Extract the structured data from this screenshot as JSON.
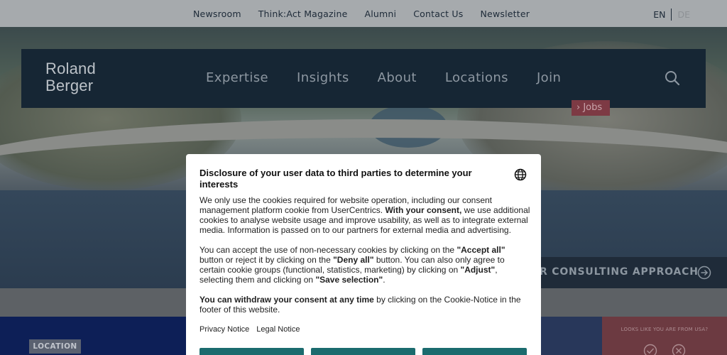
{
  "topnav": {
    "links": [
      "Newsroom",
      "Think:Act Magazine",
      "Alumni",
      "Contact Us",
      "Newsletter"
    ],
    "lang_en": "EN",
    "lang_de": "DE"
  },
  "header": {
    "logo_line1": "Roland",
    "logo_line2": "Berger",
    "menu": [
      "Expertise",
      "Insights",
      "About",
      "Locations",
      "Join"
    ],
    "search_icon": "search-icon"
  },
  "hero": {
    "jobs_label": "› Jobs",
    "approach_label": "R CONSULTING APPROACH",
    "approach_icon": "arrow-right-circle-icon"
  },
  "bottom": {
    "location_badge": "LOCATION",
    "geo_prompt": "LOOKS LIKE YOU ARE FROM USA?",
    "geo_icons": [
      "check-circle-icon",
      "close-circle-icon"
    ]
  },
  "cookie": {
    "title": "Disclosure of your user data to third parties to determine your interests",
    "p1_a": "We only use the cookies required for website operation, including our consent management platform cookie from UserCentrics. ",
    "p1_b": "With your consent,",
    "p1_c": " we use additional cookies to analyse website usage and improve usability, as well as to integrate external media. Information is passed on to our partners for external media and advertising.",
    "p2_a": "You can accept the use of non-necessary cookies by clicking on the ",
    "p2_b": "\"Accept all\"",
    "p2_c": " button or reject it by clicking on the ",
    "p2_d": "\"Deny all\"",
    "p2_e": " button. You can also only agree to certain cookie groups (functional, statistics, marketing) by clicking on ",
    "p2_f": "\"Adjust\"",
    "p2_g": ", selecting them and clicking on ",
    "p2_h": "\"Save selection\"",
    "p2_i": ".",
    "p3_a": "You can withdraw your consent at any time",
    "p3_b": " by clicking on the Cookie-Notice in the footer of this website.",
    "privacy_link": "Privacy Notice",
    "legal_link": "Legal Notice",
    "buttons": [
      "",
      "",
      ""
    ],
    "globe_icon": "globe-icon"
  },
  "colors": {
    "nav_bg": "#162634",
    "cookie_button": "#1b6b6e",
    "jobs_bg": "#7d3a44",
    "location_panel": "#0d1f57"
  }
}
